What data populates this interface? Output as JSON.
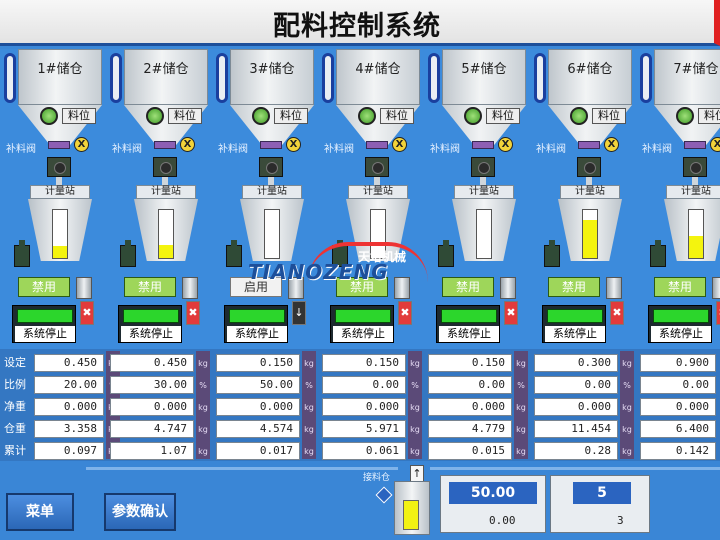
{
  "title": "配料控制系统",
  "logo": {
    "cn": "天增机械",
    "en": "TIANOZENG"
  },
  "plant": {
    "level_label": "料位",
    "refill_valve_label": "补料阀",
    "scale_label": "计量站",
    "units": [
      {
        "name": "1#储仓",
        "mode": "禁用",
        "status": "系统停止",
        "flag": "x",
        "fill": 0.25
      },
      {
        "name": "2#储仓",
        "mode": "禁用",
        "status": "系统停止",
        "flag": "x",
        "fill": 0.28
      },
      {
        "name": "3#储仓",
        "mode": "启用",
        "status": "系统停止",
        "flag": "arrow",
        "fill": 0
      },
      {
        "name": "4#储仓",
        "mode": "禁用",
        "status": "系统停止",
        "flag": "x",
        "fill": 0
      },
      {
        "name": "5#储仓",
        "mode": "禁用",
        "status": "系统停止",
        "flag": "x",
        "fill": 0
      },
      {
        "name": "6#储仓",
        "mode": "禁用",
        "status": "系统停止",
        "flag": "x",
        "fill": 0.8
      },
      {
        "name": "7#储仓",
        "mode": "禁用",
        "status": "系统停止",
        "flag": "x",
        "fill": 0.45
      }
    ]
  },
  "table": {
    "row_labels": [
      "设定",
      "比例",
      "净重",
      "仓重",
      "累计"
    ],
    "unit_labels": [
      "kg",
      "%",
      "kg",
      "kg",
      "kg"
    ],
    "columns": [
      [
        "0.450",
        "20.00",
        "0.000",
        "3.358",
        "0.097"
      ],
      [
        "0.450",
        "30.00",
        "0.000",
        "4.747",
        "1.07"
      ],
      [
        "0.150",
        "50.00",
        "0.000",
        "4.574",
        "0.017"
      ],
      [
        "0.150",
        "0.00",
        "0.000",
        "5.971",
        "0.061"
      ],
      [
        "0.150",
        "0.00",
        "0.000",
        "4.779",
        "0.015"
      ],
      [
        "0.300",
        "0.00",
        "0.000",
        "11.454",
        "0.28"
      ],
      [
        "0.900",
        "0.00",
        "0.000",
        "6.400",
        "0.142"
      ]
    ]
  },
  "bottom": {
    "menu_button": "菜单",
    "confirm_button": "参数确认",
    "blank_label": "接料仓",
    "up_arrow": "↑",
    "sum1_top": "50.00",
    "sum1_bottom": "0.00",
    "sum2_top": "5",
    "sum2_bottom": "3"
  },
  "colors": {
    "accent": "#2b64c0",
    "green": "#2cd62c",
    "yellow": "#f2f212",
    "red": "#e23b3b"
  }
}
